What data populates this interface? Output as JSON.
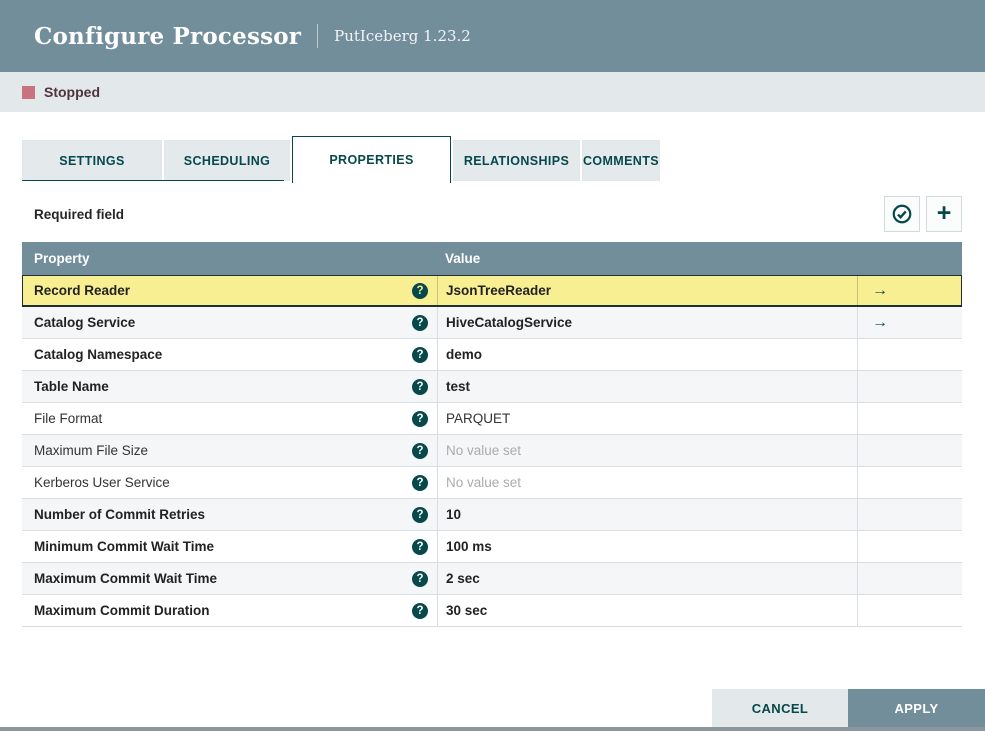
{
  "colors": {
    "accent": "#07484A",
    "header_bar": "#728E9B",
    "status_bar_bg": "#E3E8EB",
    "stopped_icon": "#C9737E",
    "selected_row": "#F8EE92",
    "alt_row": "#F4F6F7",
    "table_header_bg": "#728E9B"
  },
  "header": {
    "title": "Configure Processor",
    "subtitle": "PutIceberg 1.23.2"
  },
  "status": {
    "label": "Stopped"
  },
  "tabs": [
    {
      "label": "SETTINGS",
      "active": false
    },
    {
      "label": "SCHEDULING",
      "active": false
    },
    {
      "label": "PROPERTIES",
      "active": true
    },
    {
      "label": "RELATIONSHIPS",
      "active": false
    },
    {
      "label": "COMMENTS",
      "active": false
    }
  ],
  "toolbar": {
    "required_label": "Required field",
    "verify_button_icon": "check-circle-icon",
    "add_button_icon": "plus-icon",
    "plus_glyph": "+"
  },
  "table": {
    "columns": [
      "Property",
      "Value"
    ],
    "help_glyph": "?",
    "arrow_glyph": "→",
    "rows": [
      {
        "property": "Record Reader",
        "value": "JsonTreeReader",
        "required": true,
        "placeholder": false,
        "arrow": true,
        "selected": true
      },
      {
        "property": "Catalog Service",
        "value": "HiveCatalogService",
        "required": true,
        "placeholder": false,
        "arrow": true,
        "selected": false
      },
      {
        "property": "Catalog Namespace",
        "value": "demo",
        "required": true,
        "placeholder": false,
        "arrow": false,
        "selected": false
      },
      {
        "property": "Table Name",
        "value": "test",
        "required": true,
        "placeholder": false,
        "arrow": false,
        "selected": false
      },
      {
        "property": "File Format",
        "value": "PARQUET",
        "required": false,
        "placeholder": false,
        "arrow": false,
        "selected": false
      },
      {
        "property": "Maximum File Size",
        "value": "No value set",
        "required": false,
        "placeholder": true,
        "arrow": false,
        "selected": false
      },
      {
        "property": "Kerberos User Service",
        "value": "No value set",
        "required": false,
        "placeholder": true,
        "arrow": false,
        "selected": false
      },
      {
        "property": "Number of Commit Retries",
        "value": "10",
        "required": true,
        "placeholder": false,
        "arrow": false,
        "selected": false
      },
      {
        "property": "Minimum Commit Wait Time",
        "value": "100 ms",
        "required": true,
        "placeholder": false,
        "arrow": false,
        "selected": false
      },
      {
        "property": "Maximum Commit Wait Time",
        "value": "2 sec",
        "required": true,
        "placeholder": false,
        "arrow": false,
        "selected": false
      },
      {
        "property": "Maximum Commit Duration",
        "value": "30 sec",
        "required": true,
        "placeholder": false,
        "arrow": false,
        "selected": false
      }
    ]
  },
  "footer": {
    "cancel_label": "CANCEL",
    "apply_label": "APPLY"
  }
}
